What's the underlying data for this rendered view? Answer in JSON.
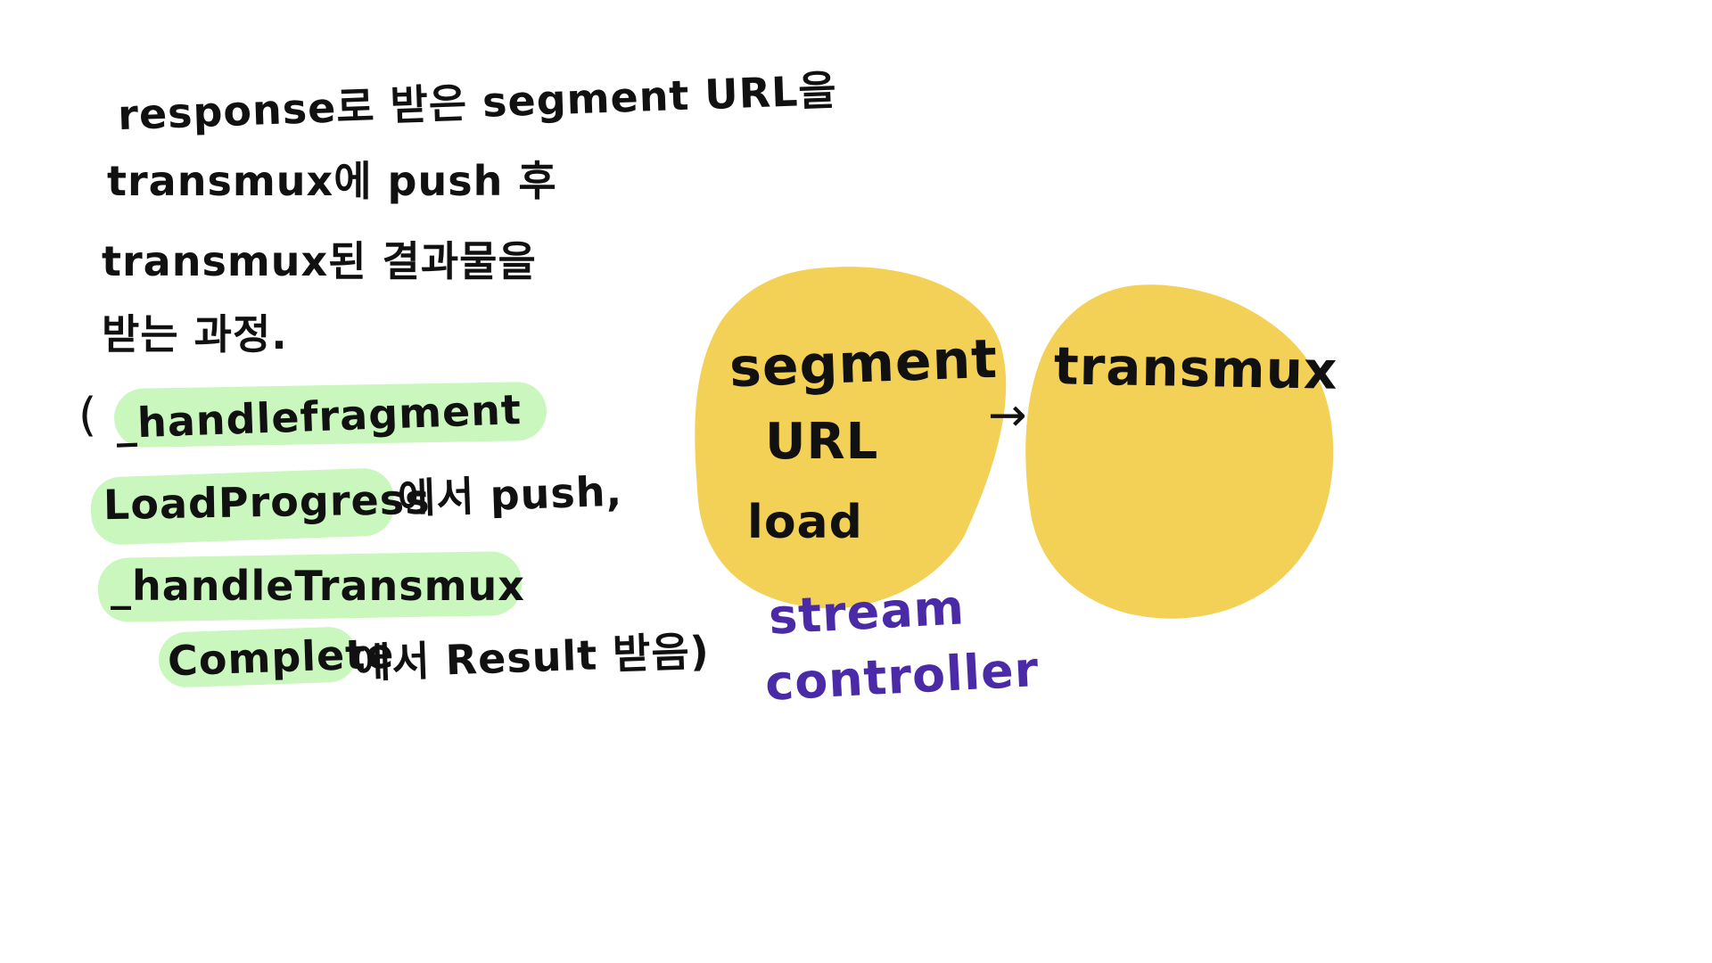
{
  "notes": {
    "line1": "response로 받은 segment URL을",
    "line2": "transmux에 push 후",
    "line3": "transmux된 결과물을",
    "line4": "받는 과정.",
    "line5_paren": "(",
    "line5_fn": "_handlefragment",
    "line6_fn": "LoadProgress",
    "line6_rest": "에서 push,",
    "line7_fn": "_handleTransmux",
    "line8_fn": "Complete",
    "line8_rest": "에서 Result 받음)"
  },
  "diagram": {
    "segment_blob": {
      "line1": "segment",
      "line2": "URL",
      "line3": "load"
    },
    "arrow": "→",
    "transmux_blob": {
      "label": "transmux"
    },
    "caption": {
      "line1": "stream",
      "line2": "controller"
    }
  },
  "colors": {
    "blob_fill": "#f3d056",
    "highlight": "#c9f7bd",
    "ink": "#111111",
    "caption_ink": "#4a2aa6"
  }
}
